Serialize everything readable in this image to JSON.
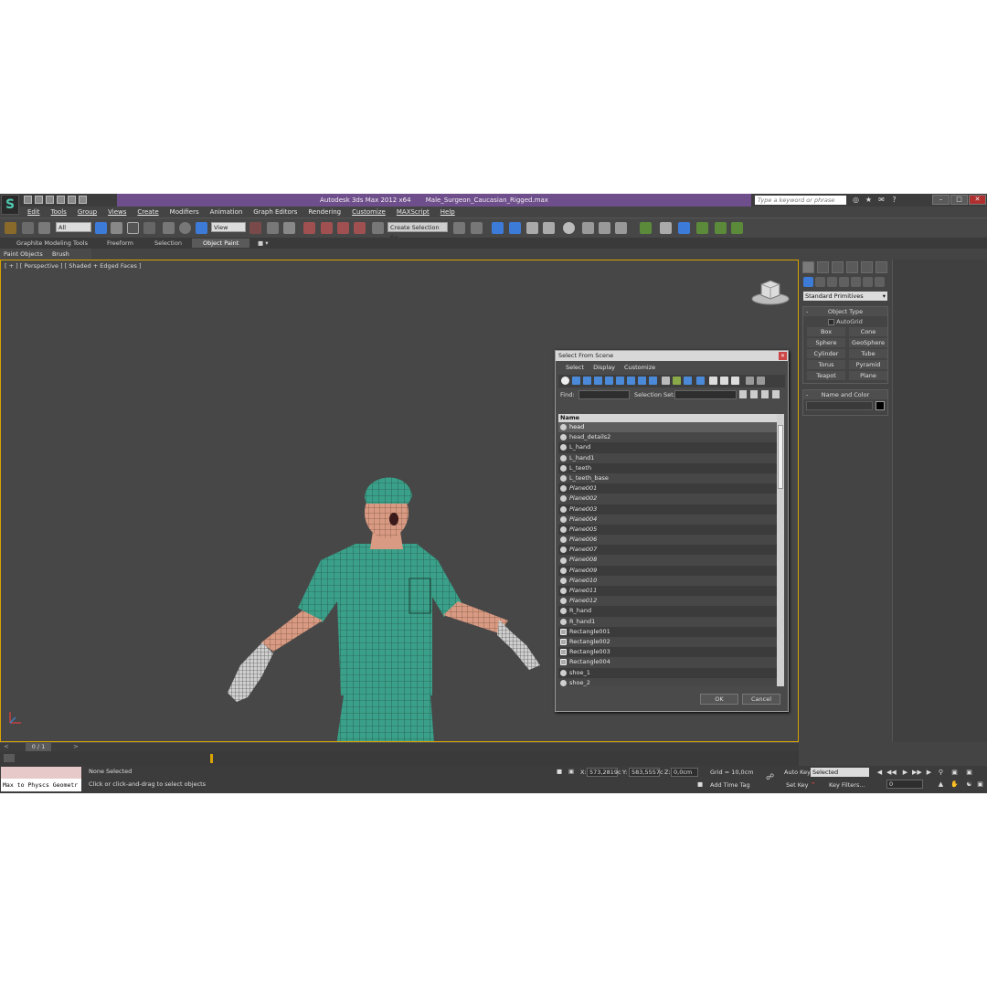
{
  "app": {
    "title": "Autodesk 3ds Max  2012 x64",
    "filename": "Male_Surgeon_Caucasian_Rigged.max",
    "search_placeholder": "Type a keyword or phrase"
  },
  "menu": [
    "Edit",
    "Tools",
    "Group",
    "Views",
    "Create",
    "Modifiers",
    "Animation",
    "Graph Editors",
    "Rendering",
    "Customize",
    "MAXScript",
    "Help"
  ],
  "toolbar": {
    "filter_value": "All",
    "refcoord_value": "View",
    "named_selection_value": "Create Selection Se"
  },
  "ribbon": {
    "tabs": [
      "Graphite Modeling Tools",
      "Freeform",
      "Selection",
      "Object Paint"
    ],
    "active_tab": "Object Paint",
    "sub_items": [
      "Paint Objects",
      "Brush Settings"
    ]
  },
  "viewport": {
    "label": "[ + ] [ Perspective ] [ Shaded + Edged Faces ]"
  },
  "command_panel": {
    "category": "Standard Primitives",
    "object_type_title": "Object Type",
    "autogrid_label": "AutoGrid",
    "object_types": [
      "Box",
      "Cone",
      "Sphere",
      "GeoSphere",
      "Cylinder",
      "Tube",
      "Torus",
      "Pyramid",
      "Teapot",
      "Plane"
    ],
    "name_color_title": "Name and Color"
  },
  "dialog": {
    "title": "Select From Scene",
    "menu": [
      "Select",
      "Display",
      "Customize"
    ],
    "find_label": "Find:",
    "selection_set_label": "Selection Set:",
    "column_name": "Name",
    "items": [
      {
        "name": "head",
        "kind": "mesh",
        "italic": false
      },
      {
        "name": "head_details2",
        "kind": "mesh",
        "italic": false
      },
      {
        "name": "L_hand",
        "kind": "mesh",
        "italic": false
      },
      {
        "name": "L_hand1",
        "kind": "mesh",
        "italic": false
      },
      {
        "name": "L_teeth",
        "kind": "mesh",
        "italic": false
      },
      {
        "name": "L_teeth_base",
        "kind": "mesh",
        "italic": false
      },
      {
        "name": "Plane001",
        "kind": "mesh",
        "italic": true
      },
      {
        "name": "Plane002",
        "kind": "mesh",
        "italic": true
      },
      {
        "name": "Plane003",
        "kind": "mesh",
        "italic": true
      },
      {
        "name": "Plane004",
        "kind": "mesh",
        "italic": true
      },
      {
        "name": "Plane005",
        "kind": "mesh",
        "italic": true
      },
      {
        "name": "Plane006",
        "kind": "mesh",
        "italic": true
      },
      {
        "name": "Plane007",
        "kind": "mesh",
        "italic": true
      },
      {
        "name": "Plane008",
        "kind": "mesh",
        "italic": true
      },
      {
        "name": "Plane009",
        "kind": "mesh",
        "italic": true
      },
      {
        "name": "Plane010",
        "kind": "mesh",
        "italic": true
      },
      {
        "name": "Plane011",
        "kind": "mesh",
        "italic": true
      },
      {
        "name": "Plane012",
        "kind": "mesh",
        "italic": true
      },
      {
        "name": "R_hand",
        "kind": "mesh",
        "italic": false
      },
      {
        "name": "R_hand1",
        "kind": "mesh",
        "italic": false
      },
      {
        "name": "Rectangle001",
        "kind": "shape",
        "italic": false
      },
      {
        "name": "Rectangle002",
        "kind": "shape",
        "italic": false
      },
      {
        "name": "Rectangle003",
        "kind": "shape",
        "italic": false
      },
      {
        "name": "Rectangle004",
        "kind": "shape",
        "italic": false
      },
      {
        "name": "shoe_1",
        "kind": "mesh",
        "italic": false
      },
      {
        "name": "shoe_2",
        "kind": "mesh",
        "italic": false
      }
    ],
    "selected_item": "head",
    "ok_label": "OK",
    "cancel_label": "Cancel"
  },
  "timeline": {
    "frame_label": "0 / 1"
  },
  "status": {
    "maxscript_text": "Max to Physcs Geometr",
    "selection_text": "None Selected",
    "prompt_text": "Click or click-and-drag to select objects",
    "x_label": "X:",
    "x_value": "573,2819c",
    "y_label": "Y:",
    "y_value": "583,5557c",
    "z_label": "Z:",
    "z_value": "0,0cm",
    "grid_text": "Grid = 10,0cm",
    "add_time_tag": "Add Time Tag",
    "auto_key": "Auto Key",
    "set_key": "Set Key",
    "key_mode_value": "Selected",
    "key_filters": "Key Filters...",
    "current_frame": "0"
  },
  "colors": {
    "title_accent": "#6f4e8c",
    "viewport_border": "#d8a300",
    "scrub_color": "#4aa58c"
  }
}
